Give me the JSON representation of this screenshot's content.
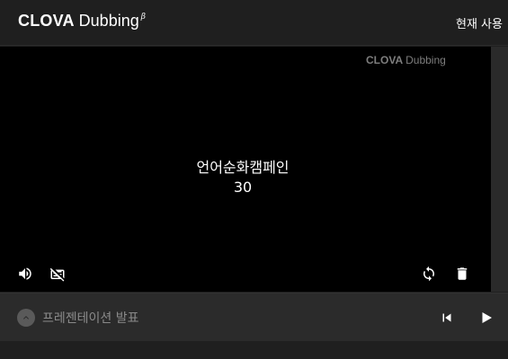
{
  "header": {
    "logo_strong": "CLOVA",
    "logo_light": "Dubbing",
    "logo_beta": "β",
    "right_text": "현재 사용"
  },
  "video": {
    "watermark_strong": "CLOVA",
    "watermark_light": "Dubbing",
    "caption_line1": "언어순화캠페인",
    "caption_line2": "30",
    "icons": {
      "volume": "volume-icon",
      "subtitles": "subtitles-off-icon",
      "refresh": "refresh-icon",
      "delete": "trash-icon"
    }
  },
  "bottom": {
    "title": "프레젠테이션 발표",
    "icons": {
      "expand": "chevron-up-icon",
      "skip_previous": "skip-previous-icon",
      "play": "play-icon"
    }
  },
  "colors": {
    "background": "#1f1f1f",
    "video_bg": "#000000",
    "bottom_bar": "#2b2b2b",
    "muted_text": "#8a8a8a",
    "watermark": "#7e7e7e"
  }
}
